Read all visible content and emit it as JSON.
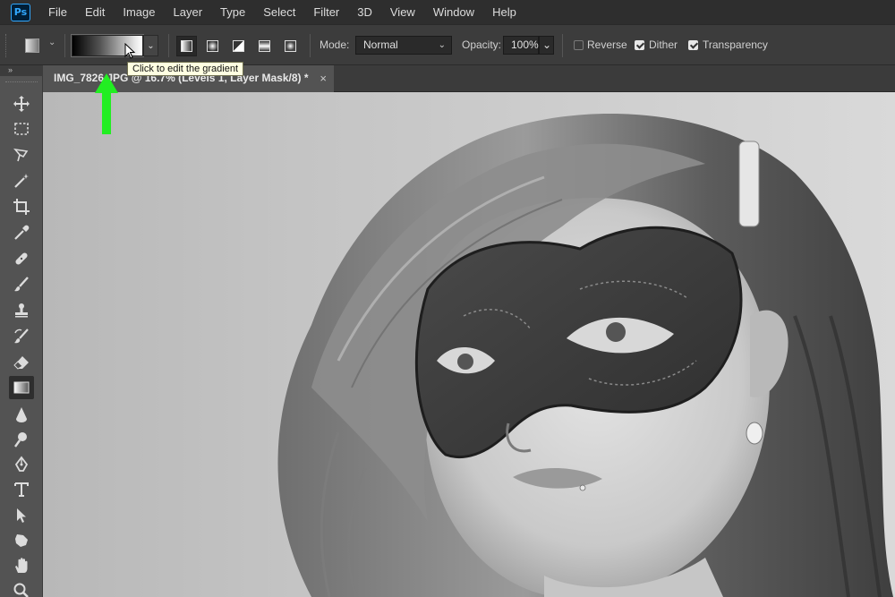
{
  "app": {
    "logo_text": "Ps"
  },
  "menu": [
    "File",
    "Edit",
    "Image",
    "Layer",
    "Type",
    "Select",
    "Filter",
    "3D",
    "View",
    "Window",
    "Help"
  ],
  "options": {
    "gradient_types": [
      "linear",
      "radial",
      "angle",
      "reflected",
      "diamond"
    ],
    "selected_gradient_type": "linear",
    "mode_label": "Mode:",
    "mode_value": "Normal",
    "opacity_label": "Opacity:",
    "opacity_value": "100%",
    "reverse_label": "Reverse",
    "reverse_checked": false,
    "dither_label": "Dither",
    "dither_checked": true,
    "transparency_label": "Transparency",
    "transparency_checked": true
  },
  "tooltip": {
    "text": "Click to edit the gradient"
  },
  "document_tab": {
    "title": "IMG_7826.JPG @ 16.7% (Levels 1, Layer Mask/8) *",
    "close_symbol": "×"
  },
  "tools": [
    "move-tool",
    "marquee-tool",
    "lasso-tool",
    "magic-wand-tool",
    "crop-tool",
    "eyedropper-tool",
    "healing-brush-tool",
    "brush-tool",
    "clone-stamp-tool",
    "history-brush-tool",
    "eraser-tool",
    "gradient-tool",
    "blur-tool",
    "dodge-tool",
    "pen-tool",
    "type-tool",
    "path-selection-tool",
    "shape-tool",
    "hand-tool",
    "zoom-tool"
  ],
  "selected_tool": "gradient-tool",
  "colors": {
    "menubar": "#2e2e2e",
    "panel": "#535353",
    "options": "#3c3c3c",
    "arrow": "#22ee22",
    "tooltip_bg": "#ffffe1"
  }
}
